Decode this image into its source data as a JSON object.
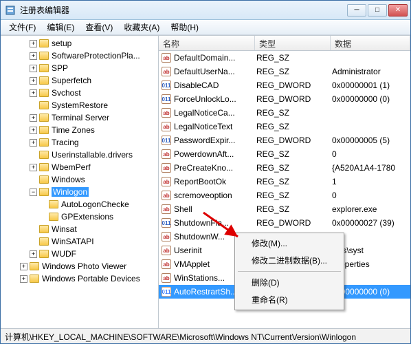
{
  "window": {
    "title": "注册表编辑器"
  },
  "menu": {
    "file": "文件(F)",
    "edit": "编辑(E)",
    "view": "查看(V)",
    "favorites": "收藏夹(A)",
    "help": "帮助(H)"
  },
  "columns": {
    "name": "名称",
    "type": "类型",
    "data": "数据"
  },
  "tree": [
    {
      "depth": 3,
      "expand": "+",
      "label": "setup"
    },
    {
      "depth": 3,
      "expand": "+",
      "label": "SoftwareProtectionPla..."
    },
    {
      "depth": 3,
      "expand": "+",
      "label": "SPP"
    },
    {
      "depth": 3,
      "expand": "+",
      "label": "Superfetch"
    },
    {
      "depth": 3,
      "expand": "+",
      "label": "Svchost"
    },
    {
      "depth": 3,
      "expand": "",
      "label": "SystemRestore"
    },
    {
      "depth": 3,
      "expand": "+",
      "label": "Terminal Server"
    },
    {
      "depth": 3,
      "expand": "+",
      "label": "Time Zones"
    },
    {
      "depth": 3,
      "expand": "+",
      "label": "Tracing"
    },
    {
      "depth": 3,
      "expand": "",
      "label": "Userinstallable.drivers"
    },
    {
      "depth": 3,
      "expand": "+",
      "label": "WbemPerf"
    },
    {
      "depth": 3,
      "expand": "",
      "label": "Windows"
    },
    {
      "depth": 3,
      "expand": "-",
      "label": "Winlogon",
      "selected": true
    },
    {
      "depth": 4,
      "expand": "",
      "label": "AutoLogonChecke"
    },
    {
      "depth": 4,
      "expand": "",
      "label": "GPExtensions"
    },
    {
      "depth": 3,
      "expand": "",
      "label": "Winsat"
    },
    {
      "depth": 3,
      "expand": "",
      "label": "WinSATAPI"
    },
    {
      "depth": 3,
      "expand": "+",
      "label": "WUDF"
    },
    {
      "depth": 2,
      "expand": "+",
      "label": "Windows Photo Viewer"
    },
    {
      "depth": 2,
      "expand": "+",
      "label": "Windows Portable Devices"
    }
  ],
  "values": [
    {
      "name": "DefaultDomain...",
      "type": "REG_SZ",
      "data": "",
      "icon": "sz"
    },
    {
      "name": "DefaultUserNa...",
      "type": "REG_SZ",
      "data": "Administrator",
      "icon": "sz"
    },
    {
      "name": "DisableCAD",
      "type": "REG_DWORD",
      "data": "0x00000001 (1)",
      "icon": "dw"
    },
    {
      "name": "ForceUnlockLo...",
      "type": "REG_DWORD",
      "data": "0x00000000 (0)",
      "icon": "dw"
    },
    {
      "name": "LegalNoticeCa...",
      "type": "REG_SZ",
      "data": "",
      "icon": "sz"
    },
    {
      "name": "LegalNoticeText",
      "type": "REG_SZ",
      "data": "",
      "icon": "sz"
    },
    {
      "name": "PasswordExpir...",
      "type": "REG_DWORD",
      "data": "0x00000005 (5)",
      "icon": "dw"
    },
    {
      "name": "PowerdownAft...",
      "type": "REG_SZ",
      "data": "0",
      "icon": "sz"
    },
    {
      "name": "PreCreateKno...",
      "type": "REG_SZ",
      "data": "{A520A1A4-1780",
      "icon": "sz"
    },
    {
      "name": "ReportBootOk",
      "type": "REG_SZ",
      "data": "1",
      "icon": "sz"
    },
    {
      "name": "scremoveoption",
      "type": "REG_SZ",
      "data": "0",
      "icon": "sz"
    },
    {
      "name": "Shell",
      "type": "REG_SZ",
      "data": "explorer.exe",
      "icon": "sz"
    },
    {
      "name": "ShutdownFla...",
      "type": "REG_DWORD",
      "data": "0x00000027 (39)",
      "icon": "dw"
    },
    {
      "name": "ShutdownW...",
      "type": "REG_SZ",
      "data": "",
      "icon": "sz"
    },
    {
      "name": "Userinit",
      "type": "REG_SZ",
      "data": "ows\\syst",
      "icon": "sz"
    },
    {
      "name": "VMApplet",
      "type": "REG_SZ",
      "data": "Properties",
      "icon": "sz"
    },
    {
      "name": "WinStations...",
      "type": "REG_SZ",
      "data": "",
      "icon": "sz"
    },
    {
      "name": "AutoRestrartSh...",
      "type": "REG_DWORD",
      "data": "0x00000000 (0)",
      "icon": "dw",
      "selected": true
    }
  ],
  "context_menu": {
    "modify": "修改(M)...",
    "modify_binary": "修改二进制数据(B)...",
    "delete": "删除(D)",
    "rename": "重命名(R)"
  },
  "statusbar": "计算机\\HKEY_LOCAL_MACHINE\\SOFTWARE\\Microsoft\\Windows NT\\CurrentVersion\\Winlogon",
  "icon_glyph": {
    "sz": "ab",
    "dw": "011"
  }
}
